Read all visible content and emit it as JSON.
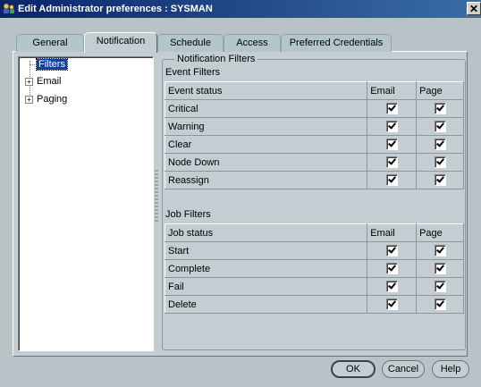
{
  "window": {
    "title": "Edit Administrator preferences : SYSMAN",
    "close_glyph": "✕"
  },
  "tabs": [
    {
      "label": "General"
    },
    {
      "label": "Notification"
    },
    {
      "label": "Schedule"
    },
    {
      "label": "Access"
    },
    {
      "label": "Preferred Credentials"
    }
  ],
  "active_tab": "Notification",
  "tree": {
    "items": [
      {
        "label": "Filters",
        "selected": true
      },
      {
        "label": "Email",
        "expandable": true
      },
      {
        "label": "Paging",
        "expandable": true
      }
    ]
  },
  "notification_filters": {
    "group_title": "Notification Filters",
    "event_filters": {
      "label": "Event Filters",
      "columns": [
        "Event status",
        "Email",
        "Page"
      ],
      "rows": [
        {
          "status": "Critical",
          "email": true,
          "page": true
        },
        {
          "status": "Warning",
          "email": true,
          "page": true
        },
        {
          "status": "Clear",
          "email": true,
          "page": true
        },
        {
          "status": "Node Down",
          "email": true,
          "page": true
        },
        {
          "status": "Reassign",
          "email": true,
          "page": true
        }
      ]
    },
    "job_filters": {
      "label": "Job Filters",
      "columns": [
        "Job status",
        "Email",
        "Page"
      ],
      "rows": [
        {
          "status": "Start",
          "email": true,
          "page": true
        },
        {
          "status": "Complete",
          "email": true,
          "page": true
        },
        {
          "status": "Fail",
          "email": true,
          "page": true
        },
        {
          "status": "Delete",
          "email": true,
          "page": true
        }
      ]
    }
  },
  "buttons": {
    "ok": "OK",
    "cancel": "Cancel",
    "help": "Help"
  }
}
